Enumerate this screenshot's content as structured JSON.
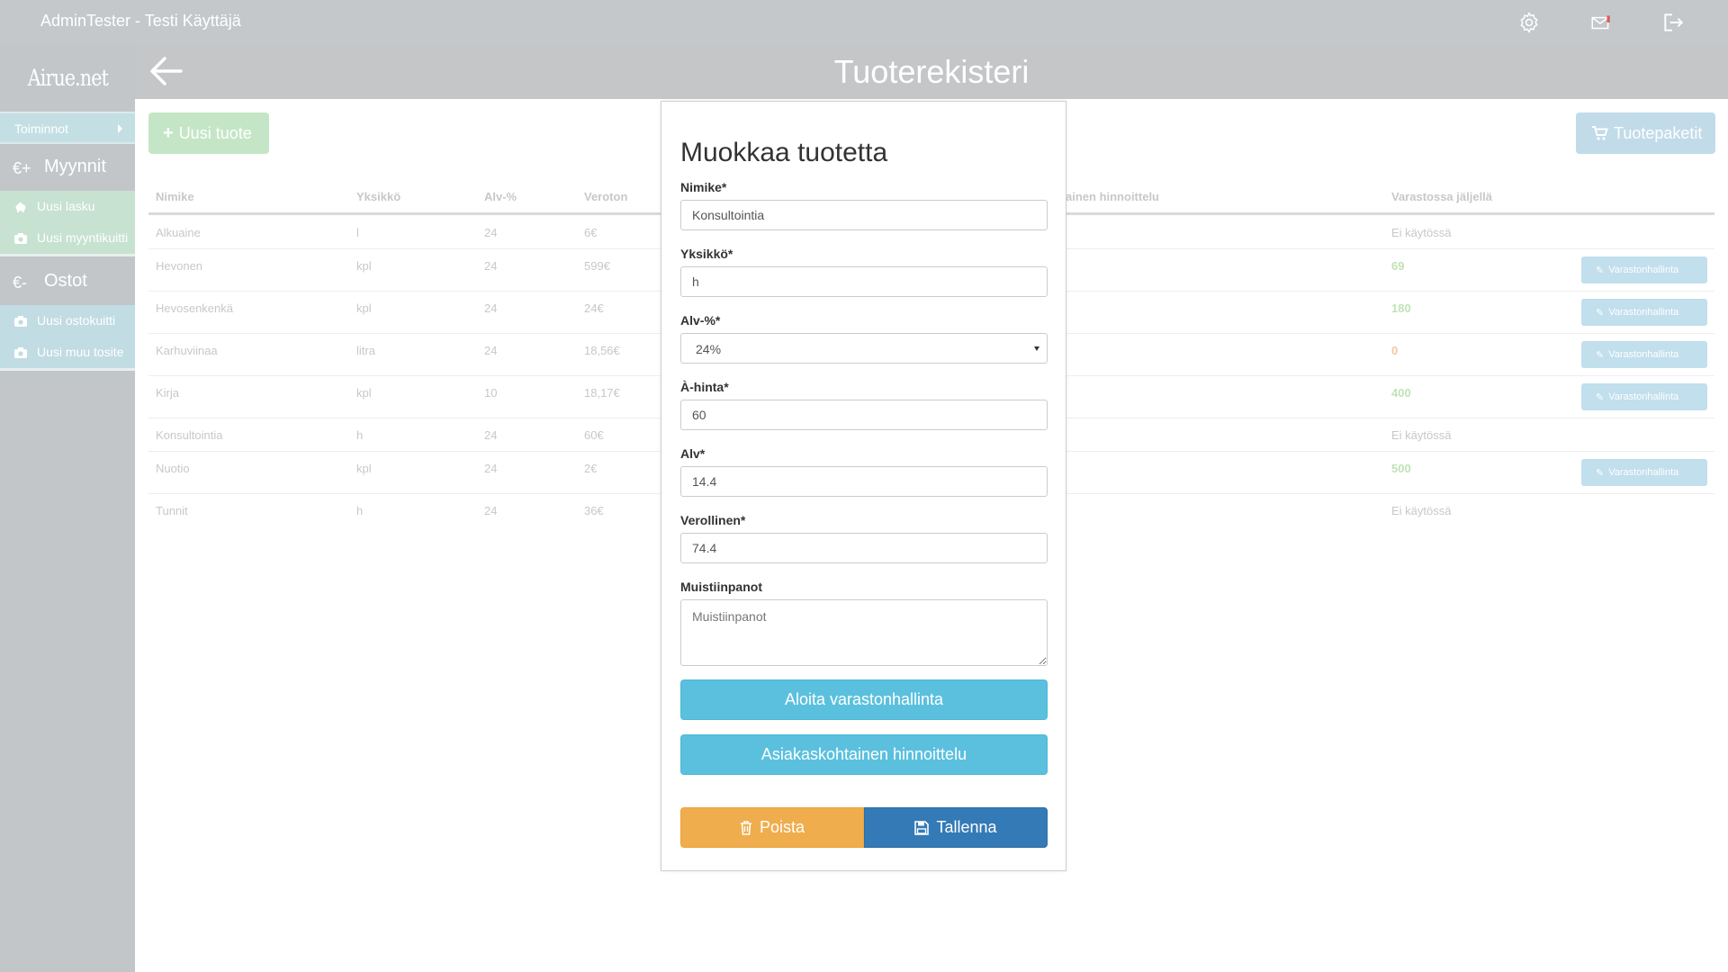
{
  "topbar": {
    "user": "AdminTester - Testi Käyttäjä",
    "icons": [
      "gear-icon",
      "envelope-icon",
      "logout-icon"
    ],
    "notification_color": "#e05a5a"
  },
  "sidebar": {
    "logo": "Airue.net",
    "toiminnot": "Toiminnot",
    "myynnit": {
      "symbol": "€+",
      "label": "Myynnit",
      "items": [
        {
          "label": "Uusi lasku",
          "icon": "piggy-bank-icon"
        },
        {
          "label": "Uusi myyntikuitti",
          "icon": "camera-icon"
        }
      ]
    },
    "ostot": {
      "symbol": "€-",
      "label": "Ostot",
      "items": [
        {
          "label": "Uusi ostokuitti",
          "icon": "camera-icon"
        },
        {
          "label": "Uusi muu tosite",
          "icon": "camera-icon"
        }
      ]
    }
  },
  "header": {
    "title": "Tuoterekisteri",
    "back_icon": "arrow-left-icon"
  },
  "buttons": {
    "new_product": "Uusi tuote",
    "packages": "Tuotepaketit"
  },
  "table": {
    "columns": [
      "Nimike",
      "Yksikkö",
      "Alv-%",
      "Veroton",
      "ainen hinnoittelu",
      "Varastossa jäljellä"
    ],
    "rows": [
      {
        "name": "Alkuaine",
        "unit": "l",
        "vat": "24",
        "price": "6€",
        "stock": "Ei käytössä",
        "button": ""
      },
      {
        "name": "Hevonen",
        "unit": "kpl",
        "vat": "24",
        "price": "599€",
        "stock": "69",
        "button": "Varastonhallinta"
      },
      {
        "name": "Hevosenkenkä",
        "unit": "kpl",
        "vat": "24",
        "price": "24€",
        "stock": "180",
        "button": "Varastonhallinta"
      },
      {
        "name": "Karhuviinaa",
        "unit": "litra",
        "vat": "24",
        "price": "18,56€",
        "stock": "0",
        "button": "Varastonhallinta"
      },
      {
        "name": "Kirja",
        "unit": "kpl",
        "vat": "10",
        "price": "18,17€",
        "stock": "400",
        "button": "Varastonhallinta"
      },
      {
        "name": "Konsultointia",
        "unit": "h",
        "vat": "24",
        "price": "60€",
        "stock": "Ei käytössä",
        "button": ""
      },
      {
        "name": "Nuotio",
        "unit": "kpl",
        "vat": "24",
        "price": "2€",
        "stock": "500",
        "button": "Varastonhallinta"
      },
      {
        "name": "Tunnit",
        "unit": "h",
        "vat": "24",
        "price": "36€",
        "stock": "Ei käytössä",
        "button": ""
      }
    ]
  },
  "modal": {
    "title": "Muokkaa tuotetta",
    "fields": {
      "nimike": {
        "label": "Nimike*",
        "value": "Konsultointia"
      },
      "yksikko": {
        "label": "Yksikkö*",
        "value": "h"
      },
      "alv_pct": {
        "label": "Alv-%*",
        "value": "24%"
      },
      "a_hinta": {
        "label": "À-hinta*",
        "value": "60"
      },
      "alv": {
        "label": "Alv*",
        "value": "14.4"
      },
      "verollinen": {
        "label": "Verollinen*",
        "value": "74.4"
      },
      "muistiinpanot": {
        "label": "Muistiinpanot",
        "placeholder": "Muistiinpanot"
      }
    },
    "btn_inventory": "Aloita varastonhallinta",
    "btn_pricing": "Asiakaskohtainen hinnoittelu",
    "btn_delete": "Poista",
    "btn_save": "Tallenna"
  },
  "colors": {
    "info": "#5bc0de",
    "warning": "#f0ad4e",
    "primary": "#337ab7"
  }
}
